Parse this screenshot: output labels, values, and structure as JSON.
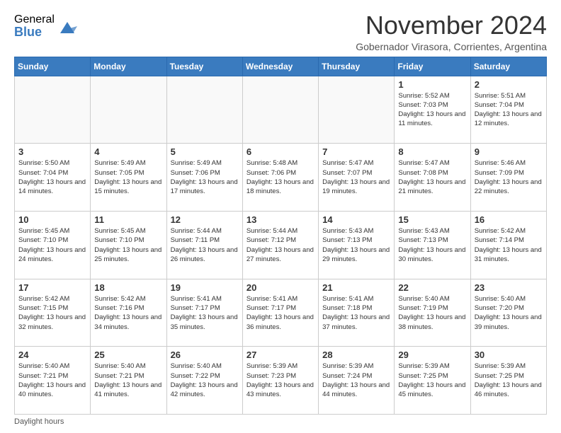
{
  "logo": {
    "general": "General",
    "blue": "Blue"
  },
  "title": "November 2024",
  "subtitle": "Gobernador Virasora, Corrientes, Argentina",
  "days_of_week": [
    "Sunday",
    "Monday",
    "Tuesday",
    "Wednesday",
    "Thursday",
    "Friday",
    "Saturday"
  ],
  "footer_label": "Daylight hours",
  "weeks": [
    [
      {
        "day": "",
        "info": ""
      },
      {
        "day": "",
        "info": ""
      },
      {
        "day": "",
        "info": ""
      },
      {
        "day": "",
        "info": ""
      },
      {
        "day": "",
        "info": ""
      },
      {
        "day": "1",
        "info": "Sunrise: 5:52 AM\nSunset: 7:03 PM\nDaylight: 13 hours and 11 minutes."
      },
      {
        "day": "2",
        "info": "Sunrise: 5:51 AM\nSunset: 7:04 PM\nDaylight: 13 hours and 12 minutes."
      }
    ],
    [
      {
        "day": "3",
        "info": "Sunrise: 5:50 AM\nSunset: 7:04 PM\nDaylight: 13 hours and 14 minutes."
      },
      {
        "day": "4",
        "info": "Sunrise: 5:49 AM\nSunset: 7:05 PM\nDaylight: 13 hours and 15 minutes."
      },
      {
        "day": "5",
        "info": "Sunrise: 5:49 AM\nSunset: 7:06 PM\nDaylight: 13 hours and 17 minutes."
      },
      {
        "day": "6",
        "info": "Sunrise: 5:48 AM\nSunset: 7:06 PM\nDaylight: 13 hours and 18 minutes."
      },
      {
        "day": "7",
        "info": "Sunrise: 5:47 AM\nSunset: 7:07 PM\nDaylight: 13 hours and 19 minutes."
      },
      {
        "day": "8",
        "info": "Sunrise: 5:47 AM\nSunset: 7:08 PM\nDaylight: 13 hours and 21 minutes."
      },
      {
        "day": "9",
        "info": "Sunrise: 5:46 AM\nSunset: 7:09 PM\nDaylight: 13 hours and 22 minutes."
      }
    ],
    [
      {
        "day": "10",
        "info": "Sunrise: 5:45 AM\nSunset: 7:10 PM\nDaylight: 13 hours and 24 minutes."
      },
      {
        "day": "11",
        "info": "Sunrise: 5:45 AM\nSunset: 7:10 PM\nDaylight: 13 hours and 25 minutes."
      },
      {
        "day": "12",
        "info": "Sunrise: 5:44 AM\nSunset: 7:11 PM\nDaylight: 13 hours and 26 minutes."
      },
      {
        "day": "13",
        "info": "Sunrise: 5:44 AM\nSunset: 7:12 PM\nDaylight: 13 hours and 27 minutes."
      },
      {
        "day": "14",
        "info": "Sunrise: 5:43 AM\nSunset: 7:13 PM\nDaylight: 13 hours and 29 minutes."
      },
      {
        "day": "15",
        "info": "Sunrise: 5:43 AM\nSunset: 7:13 PM\nDaylight: 13 hours and 30 minutes."
      },
      {
        "day": "16",
        "info": "Sunrise: 5:42 AM\nSunset: 7:14 PM\nDaylight: 13 hours and 31 minutes."
      }
    ],
    [
      {
        "day": "17",
        "info": "Sunrise: 5:42 AM\nSunset: 7:15 PM\nDaylight: 13 hours and 32 minutes."
      },
      {
        "day": "18",
        "info": "Sunrise: 5:42 AM\nSunset: 7:16 PM\nDaylight: 13 hours and 34 minutes."
      },
      {
        "day": "19",
        "info": "Sunrise: 5:41 AM\nSunset: 7:17 PM\nDaylight: 13 hours and 35 minutes."
      },
      {
        "day": "20",
        "info": "Sunrise: 5:41 AM\nSunset: 7:17 PM\nDaylight: 13 hours and 36 minutes."
      },
      {
        "day": "21",
        "info": "Sunrise: 5:41 AM\nSunset: 7:18 PM\nDaylight: 13 hours and 37 minutes."
      },
      {
        "day": "22",
        "info": "Sunrise: 5:40 AM\nSunset: 7:19 PM\nDaylight: 13 hours and 38 minutes."
      },
      {
        "day": "23",
        "info": "Sunrise: 5:40 AM\nSunset: 7:20 PM\nDaylight: 13 hours and 39 minutes."
      }
    ],
    [
      {
        "day": "24",
        "info": "Sunrise: 5:40 AM\nSunset: 7:21 PM\nDaylight: 13 hours and 40 minutes."
      },
      {
        "day": "25",
        "info": "Sunrise: 5:40 AM\nSunset: 7:21 PM\nDaylight: 13 hours and 41 minutes."
      },
      {
        "day": "26",
        "info": "Sunrise: 5:40 AM\nSunset: 7:22 PM\nDaylight: 13 hours and 42 minutes."
      },
      {
        "day": "27",
        "info": "Sunrise: 5:39 AM\nSunset: 7:23 PM\nDaylight: 13 hours and 43 minutes."
      },
      {
        "day": "28",
        "info": "Sunrise: 5:39 AM\nSunset: 7:24 PM\nDaylight: 13 hours and 44 minutes."
      },
      {
        "day": "29",
        "info": "Sunrise: 5:39 AM\nSunset: 7:25 PM\nDaylight: 13 hours and 45 minutes."
      },
      {
        "day": "30",
        "info": "Sunrise: 5:39 AM\nSunset: 7:25 PM\nDaylight: 13 hours and 46 minutes."
      }
    ]
  ]
}
